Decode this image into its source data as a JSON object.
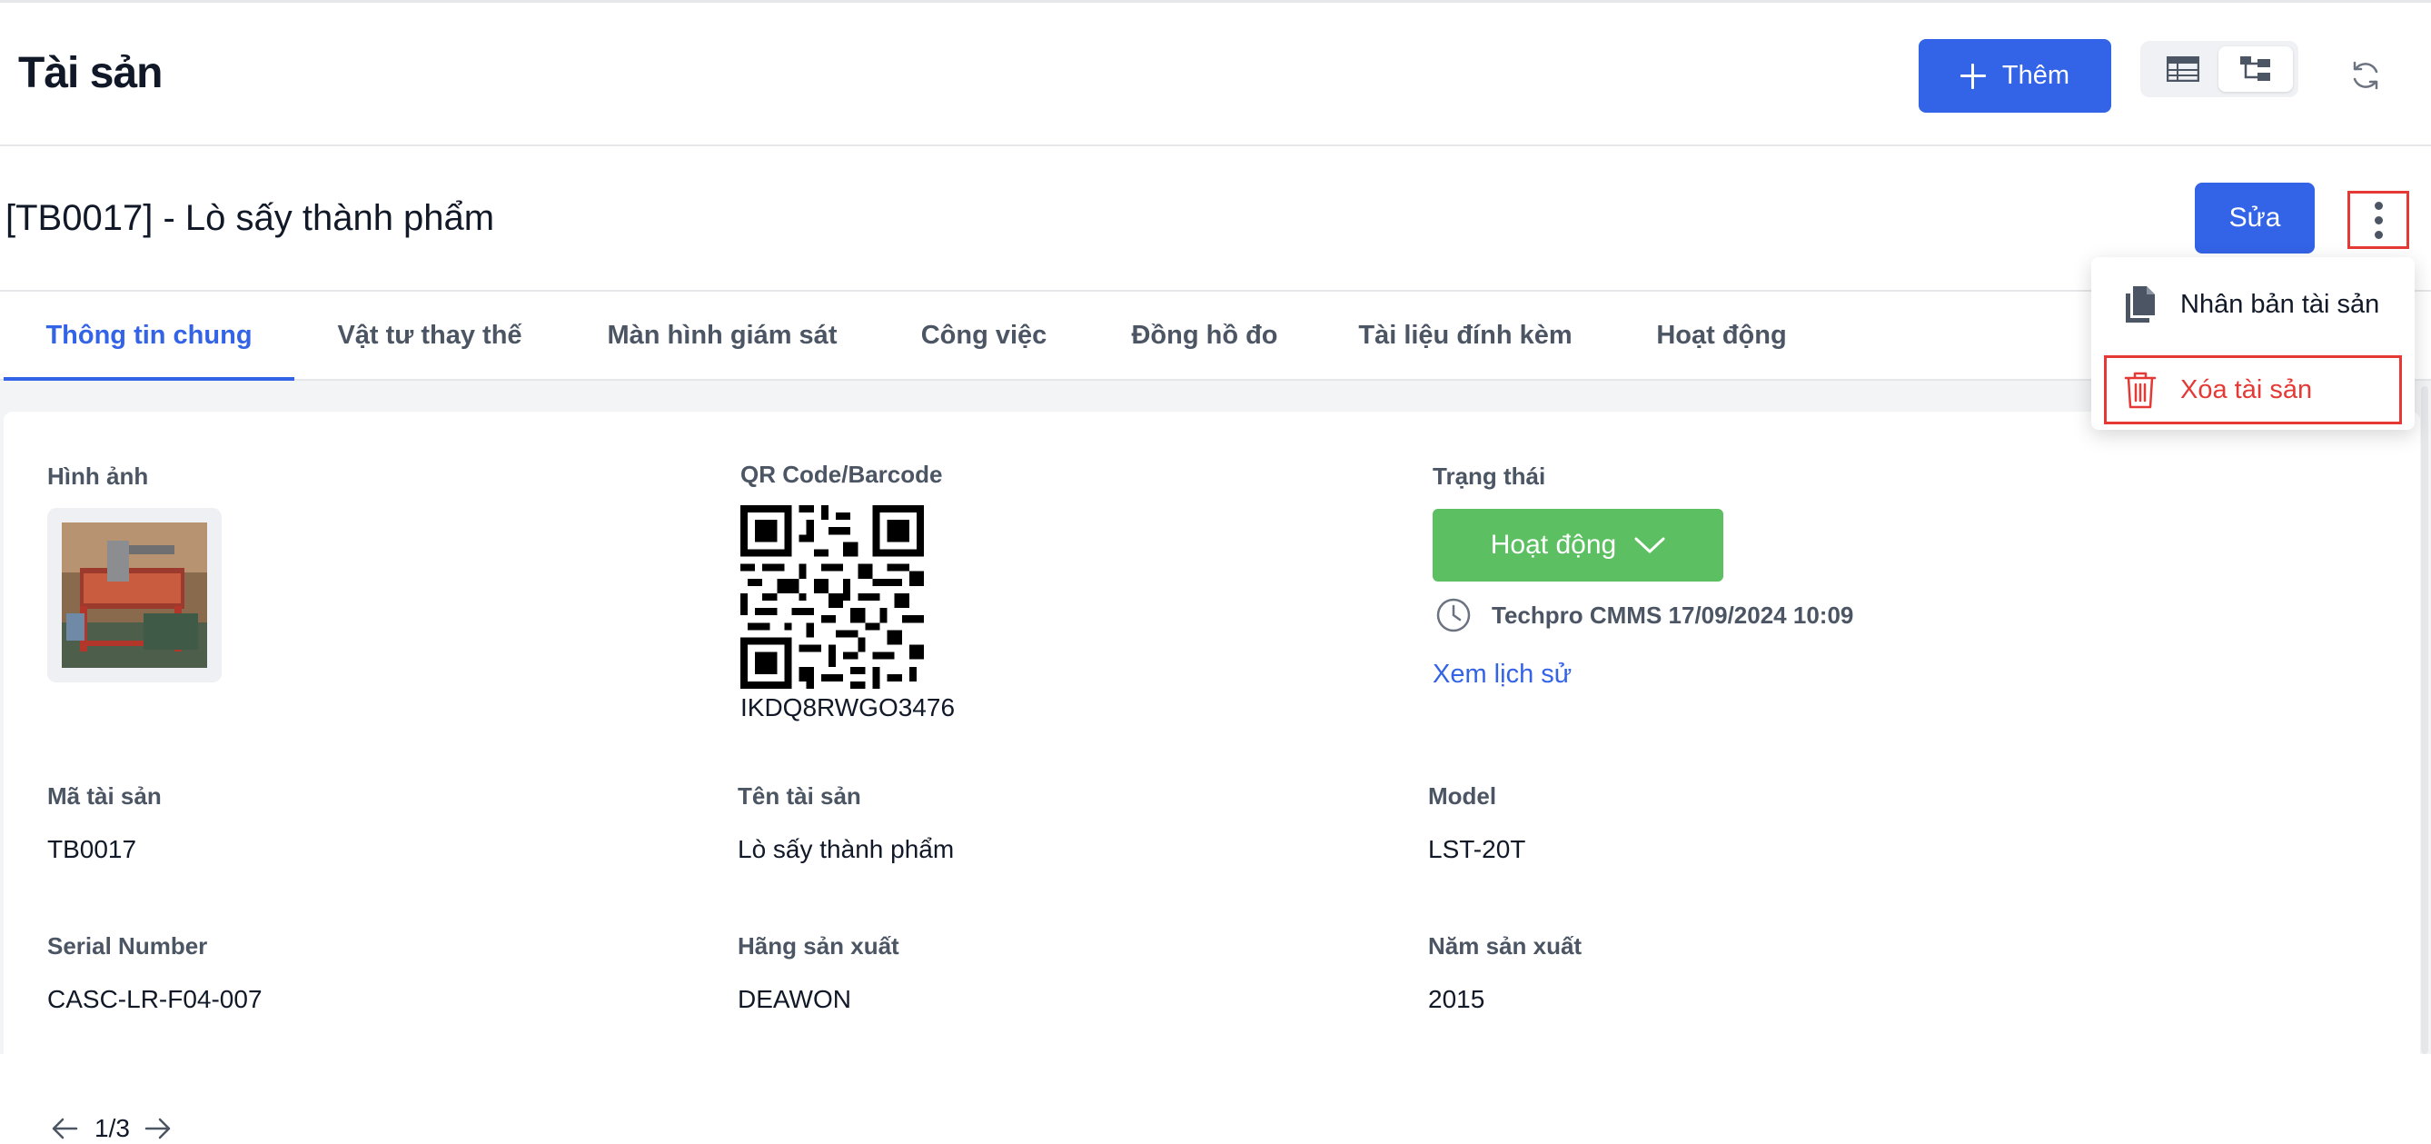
{
  "header": {
    "title": "Tài sản",
    "add_label": "Thêm",
    "icons": [
      "plus-icon",
      "table-view-icon",
      "tree-view-icon",
      "refresh-icon"
    ]
  },
  "detail": {
    "title": "[TB0017] - Lò sấy thành phẩm",
    "edit_label": "Sửa",
    "more_icon": "more-vertical-icon"
  },
  "tabs": [
    {
      "label": "Thông tin chung",
      "active": true
    },
    {
      "label": "Vật tư thay thế",
      "active": false
    },
    {
      "label": "Màn hình giám sát",
      "active": false
    },
    {
      "label": "Công việc",
      "active": false
    },
    {
      "label": "Đồng hồ đo",
      "active": false
    },
    {
      "label": "Tài liệu đính kèm",
      "active": false
    },
    {
      "label": "Hoạt động",
      "active": false
    }
  ],
  "image_section": {
    "label": "Hình ảnh",
    "pager": "1/3"
  },
  "qr_section": {
    "label": "QR Code/Barcode",
    "code": "IKDQ8RWGO3476"
  },
  "status_section": {
    "label": "Trạng thái",
    "value": "Hoạt động",
    "meta": "Techpro CMMS 17/09/2024 10:09",
    "history_link": "Xem lịch sử"
  },
  "fields": {
    "asset_code": {
      "label": "Mã tài sản",
      "value": "TB0017"
    },
    "asset_name": {
      "label": "Tên tài sản",
      "value": "Lò sấy thành phẩm"
    },
    "model": {
      "label": "Model",
      "value": "LST-20T"
    },
    "serial": {
      "label": "Serial Number",
      "value": "CASC-LR-F04-007"
    },
    "manufacturer": {
      "label": "Hãng sản xuất",
      "value": "DEAWON"
    },
    "year": {
      "label": "Năm sản xuất",
      "value": "2015"
    }
  },
  "dropdown": {
    "items": [
      {
        "label": "Nhân bản tài sản",
        "icon": "duplicate-icon"
      },
      {
        "label": "Xóa tài sản",
        "icon": "trash-icon"
      }
    ]
  },
  "colors": {
    "primary": "#3363e6",
    "success": "#5cbf62",
    "danger": "#e53935"
  }
}
